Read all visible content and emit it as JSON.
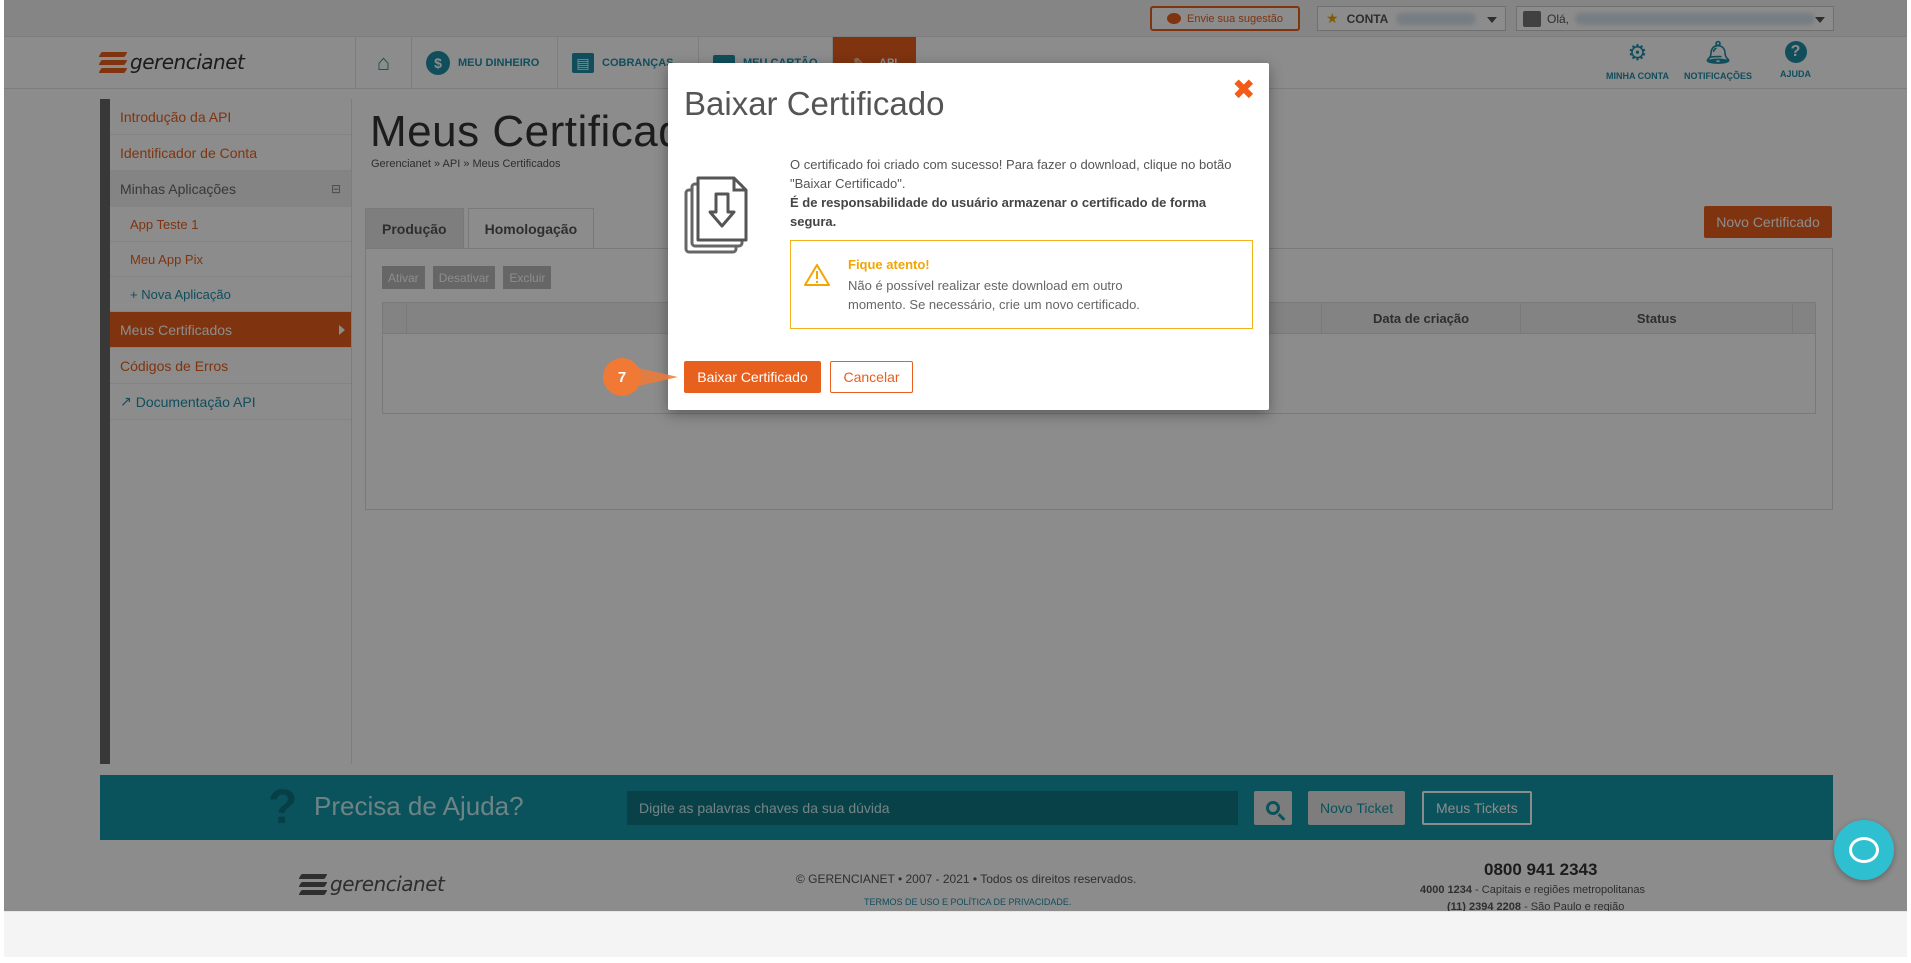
{
  "topbar": {
    "suggestion_label": "Envie sua sugestão",
    "account_label": "CONTA",
    "greeting": "Olá,"
  },
  "nav": {
    "logo_text": "gerencianet",
    "items": [
      {
        "label": "",
        "icon": "home-icon"
      },
      {
        "label": "MEU DINHEIRO",
        "icon": "dollar-icon"
      },
      {
        "label": "COBRANÇAS",
        "icon": "invoice-icon"
      },
      {
        "label": "MEU CARTÃO",
        "icon": "card-icon"
      },
      {
        "label": "API",
        "icon": "plug-icon"
      }
    ],
    "right": [
      {
        "label": "MINHA CONTA",
        "icon": "gear-icon"
      },
      {
        "label": "NOTIFICAÇÕES",
        "icon": "bell-icon"
      },
      {
        "label": "AJUDA",
        "icon": "question-icon"
      }
    ]
  },
  "sidebar": {
    "items": [
      {
        "label": "Introdução da API"
      },
      {
        "label": "Identificador de Conta"
      },
      {
        "label": "Minhas Aplicações"
      },
      {
        "label": "App Teste 1"
      },
      {
        "label": "Meu App Pix"
      },
      {
        "label": "+ Nova Aplicação"
      },
      {
        "label": "Meus Certificados"
      },
      {
        "label": "Códigos de Erros"
      },
      {
        "label": "Documentação API"
      }
    ]
  },
  "main": {
    "title": "Meus Certificados",
    "breadcrumb": "Gerencianet » API » Meus Certificados",
    "tabs": [
      {
        "label": "Produção"
      },
      {
        "label": "Homologação"
      }
    ],
    "new_certificate_label": "Novo Certificado",
    "actions": [
      "Ativar",
      "Desativar",
      "Excluir"
    ],
    "table_headers": [
      "",
      "",
      "Data de criação",
      "Status",
      ""
    ]
  },
  "help": {
    "title": "Precisa de Ajuda?",
    "search_placeholder": "Digite as palavras chaves da sua dúvida",
    "new_ticket": "Novo Ticket",
    "my_tickets": "Meus Tickets"
  },
  "footer": {
    "logo_text": "gerencianet",
    "copyright": "© GERENCIANET • 2007 - 2021 • Todos os direitos reservados.",
    "terms": "TERMOS DE USO E POLÍTICA DE PRIVACIDADE.",
    "phone_main": "0800 941 2343",
    "phone_capitals_number": "4000 1234",
    "phone_capitals_text": " - Capitais e regiões metropolitanas",
    "phone_sp_number": "(11) 2394 2208",
    "phone_sp_text": " - São Paulo e região"
  },
  "modal": {
    "title": "Baixar Certificado",
    "message": "O certificado foi criado com sucesso! Para fazer o download, clique no botão \"Baixar Certificado\".",
    "message_bold": "É de responsabilidade do usuário armazenar o certificado de forma segura.",
    "warning_title": "Fique atento!",
    "warning_text": "Não é possível realizar este download em outro momento. Se necessário, crie um novo certificado.",
    "download_label": "Baixar Certificado",
    "cancel_label": "Cancelar"
  },
  "step_badge": "7",
  "colors": {
    "brand_orange": "#e8601d",
    "brand_teal": "#1497a8",
    "warning": "#f3b21b"
  }
}
